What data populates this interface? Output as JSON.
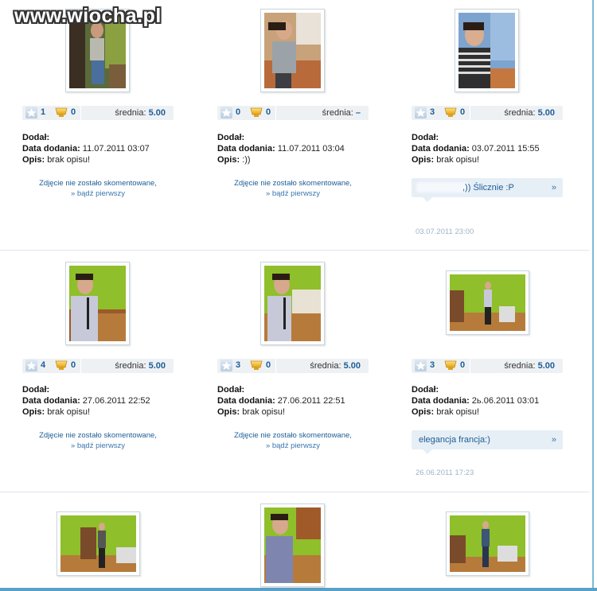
{
  "watermark": "www.wiocha.pl",
  "labels": {
    "added_by": "Dodał:",
    "date_added": "Data dodania:",
    "description": "Opis:",
    "average": "średnia:",
    "no_comment_line1": "Zdjęcie nie zostało skomentowane,",
    "no_comment_line2": "» bądź pierwszy",
    "arrow": "»"
  },
  "colors": {
    "accent": "#1c5d96",
    "rating_bg": "#eef1f4",
    "comment_bg": "#e6eef6",
    "border_blue": "#5aa1c9"
  },
  "photos": [
    {
      "stars": "1",
      "trophies": "0",
      "average": "5.00",
      "date": "11.07.2011 03:07",
      "desc": "brak opisu!",
      "comment": null,
      "comment_date": null
    },
    {
      "stars": "0",
      "trophies": "0",
      "average": "–",
      "date": "11.07.2011 03:04",
      "desc": ":))",
      "comment": null,
      "comment_date": null
    },
    {
      "stars": "3",
      "trophies": "0",
      "average": "5.00",
      "date": "03.07.2011 15:55",
      "desc": "brak opisu!",
      "comment": ",)) Ślicznie :P",
      "comment_date": "03.07.2011 23:00"
    },
    {
      "stars": "4",
      "trophies": "0",
      "average": "5.00",
      "date": "27.06.2011 22:52",
      "desc": "brak opisu!",
      "comment": null,
      "comment_date": null
    },
    {
      "stars": "3",
      "trophies": "0",
      "average": "5.00",
      "date": "27.06.2011 22:51",
      "desc": "brak opisu!",
      "comment": null,
      "comment_date": null
    },
    {
      "stars": "3",
      "trophies": "0",
      "average": "5.00",
      "date": "2ь.06.2011 03:01",
      "desc": "brak opisu!",
      "comment": "elegancja francja:)",
      "comment_date": "26.06.2011 17:23"
    }
  ]
}
